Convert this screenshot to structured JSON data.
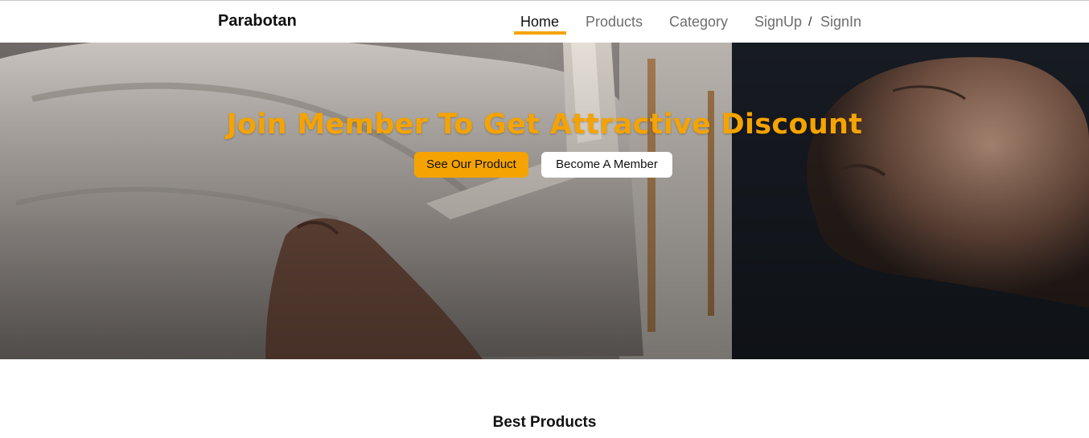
{
  "brand": {
    "name": "Parabotan"
  },
  "nav": {
    "home": "Home",
    "products": "Products",
    "category": "Category",
    "signup": "SignUp",
    "separator": "/",
    "signin": "SignIn",
    "active": "Home"
  },
  "hero": {
    "title": "Join Member To Get Attractive Discount",
    "primary_button": "See Our Product",
    "secondary_button": "Become A Member",
    "image": "furniture-upholstery-photo"
  },
  "sections": {
    "best_products_title": "Best Products"
  },
  "colors": {
    "accent": "#f5a300",
    "nav_text": "#6e6e6e",
    "nav_active": "#111111"
  }
}
